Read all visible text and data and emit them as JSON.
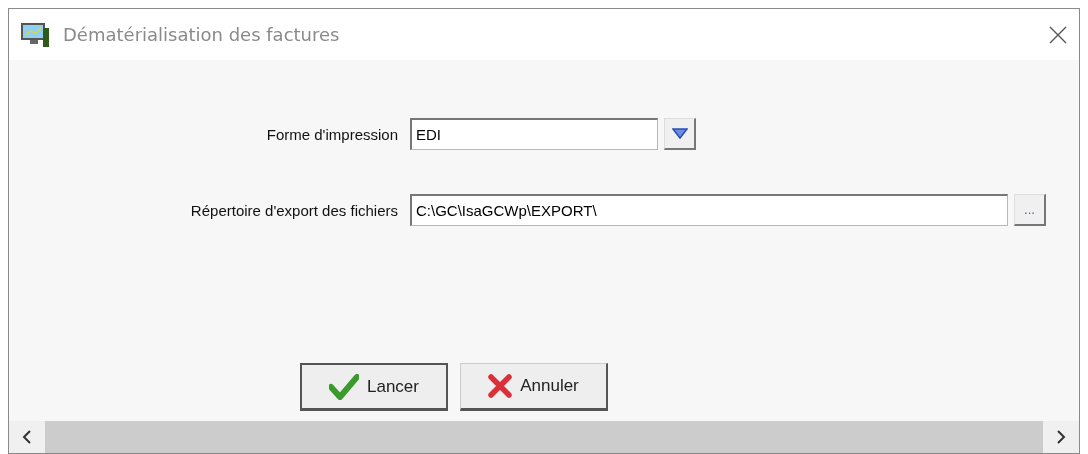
{
  "window": {
    "title": "Dématérialisation des factures"
  },
  "fields": [
    {
      "kind": "dropdown",
      "label": "Forme d'impression",
      "value": "EDI"
    },
    {
      "kind": "browse",
      "label": "Répertoire d'export des fichiers",
      "value": "C:\\GC\\IsaGCWp\\EXPORT\\",
      "button": "..."
    }
  ],
  "buttons": [
    {
      "kind": "ok",
      "label": "Lancer",
      "default": true
    },
    {
      "kind": "cancel",
      "label": "Annuler",
      "default": false
    }
  ]
}
